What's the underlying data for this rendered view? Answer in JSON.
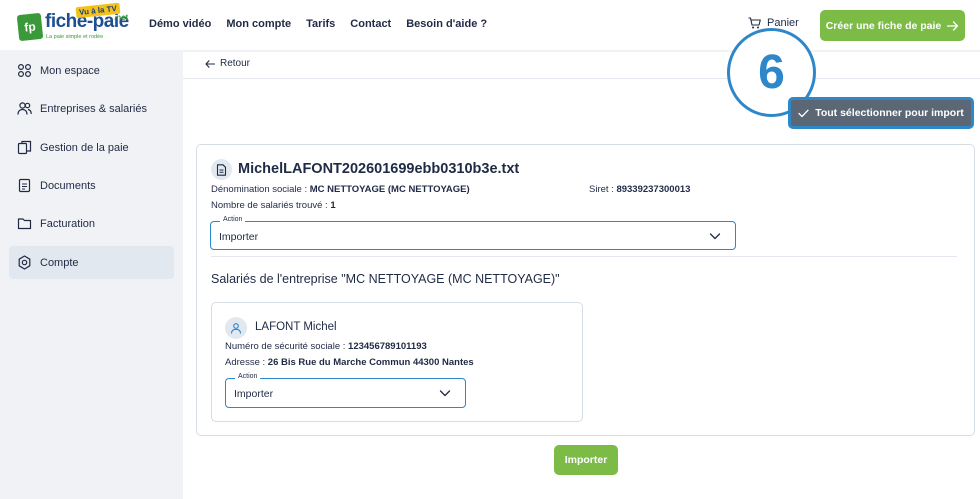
{
  "logo": {
    "badge": "fp",
    "name": "fiche-paie",
    "tv_badge": "Vu à la TV",
    "suffix": ".net",
    "slogan": "La paie simple et rodée"
  },
  "nav": {
    "items": [
      "Démo vidéo",
      "Mon compte",
      "Tarifs",
      "Contact",
      "Besoin d'aide ?"
    ]
  },
  "header": {
    "cart_label": "Panier",
    "create_label": "Créer une fiche de paie"
  },
  "sidebar": {
    "items": [
      {
        "label": "Mon espace",
        "icon": "grid-icon"
      },
      {
        "label": "Entreprises & salariés",
        "icon": "users-icon"
      },
      {
        "label": "Gestion de la paie",
        "icon": "copy-document-icon"
      },
      {
        "label": "Documents",
        "icon": "document-icon"
      },
      {
        "label": "Facturation",
        "icon": "folder-icon"
      },
      {
        "label": "Compte",
        "icon": "gear-icon"
      }
    ],
    "active_index": 5
  },
  "main": {
    "back_label": "Retour",
    "step_number": "6",
    "select_all_label": "Tout sélectionner pour import",
    "file": {
      "name": "MichelLAFONT202601699ebb0310b3e.txt",
      "company_label": "Dénomination sociale :",
      "company_value": "MC NETTOYAGE (MC NETTOYAGE)",
      "siret_label": "Siret :",
      "siret_value": "89339237300013",
      "employees_label": "Nombre de salariés trouvé :",
      "employees_value": "1",
      "action_legend": "Action",
      "action_value": "Importer"
    },
    "section_title": "Salariés de l'entreprise \"MC NETTOYAGE (MC NETTOYAGE)\"",
    "employee": {
      "name": "LAFONT Michel",
      "ssn_label": "Numéro de sécurité sociale :",
      "ssn_value": "123456789101193",
      "address_label": "Adresse :",
      "address_value": "26 Bis Rue du Marche Commun 44300 Nantes",
      "action_legend": "Action",
      "action_value": "Importer"
    },
    "import_button_label": "Importer"
  },
  "colors": {
    "brand_green": "#7bbb46",
    "accent_blue": "#2e87c8",
    "dark_button": "#5b6775",
    "text": "#1f2a44"
  }
}
